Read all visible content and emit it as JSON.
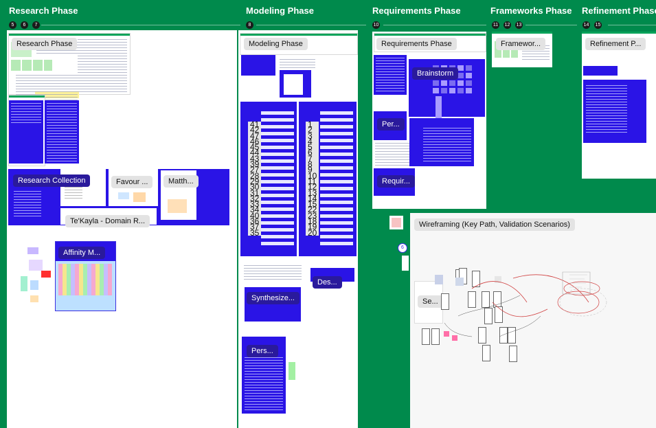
{
  "phases": [
    {
      "title": "Research Phase",
      "badges": [
        "5",
        "6",
        "7"
      ]
    },
    {
      "title": "Modeling Phase",
      "badges": [
        "8"
      ]
    },
    {
      "title": "Requirements Phase",
      "badges": [
        "10"
      ]
    },
    {
      "title": "Frameworks Phase",
      "badges": [
        "11",
        "12",
        "13"
      ]
    },
    {
      "title": "Refinement Phase",
      "badges": [
        "14",
        "15"
      ]
    }
  ],
  "frames": {
    "research_phase": "Research Phase",
    "research_collection": "Research Collection",
    "favourites": "Favour ...",
    "matth": "Matth...",
    "tekayla": "Te'Kayla - Domain R...",
    "affinity": "Affinity M...",
    "modeling_phase": "Modeling Phase",
    "synthesize": "Synthesize...",
    "des": "Des...",
    "pers": "Pers...",
    "requirements_phase": "Requirements Phase",
    "brainstorm": "Brainstorm",
    "per": "Per...",
    "requir": "Requir...",
    "frameworks": "Framewor...",
    "refinement": "Refinement P...",
    "wireframing": "Wireframing (Key Path, Validation Scenarios)",
    "se": "Se...",
    "small_badge": "6"
  },
  "left_numbers": [
    "41",
    "42",
    "47",
    "46",
    "45",
    "44",
    "43",
    "39",
    "27",
    "28",
    "29",
    "30",
    "31",
    "32",
    "33",
    "34",
    "40",
    "36",
    "37",
    "35"
  ],
  "right_numbers": [
    "1",
    "2",
    "3",
    "4",
    "5",
    "6",
    "7",
    "8",
    "9",
    "10",
    "11",
    "12",
    "13",
    "14",
    "15",
    "22",
    "23",
    "18",
    "19",
    "20"
  ]
}
